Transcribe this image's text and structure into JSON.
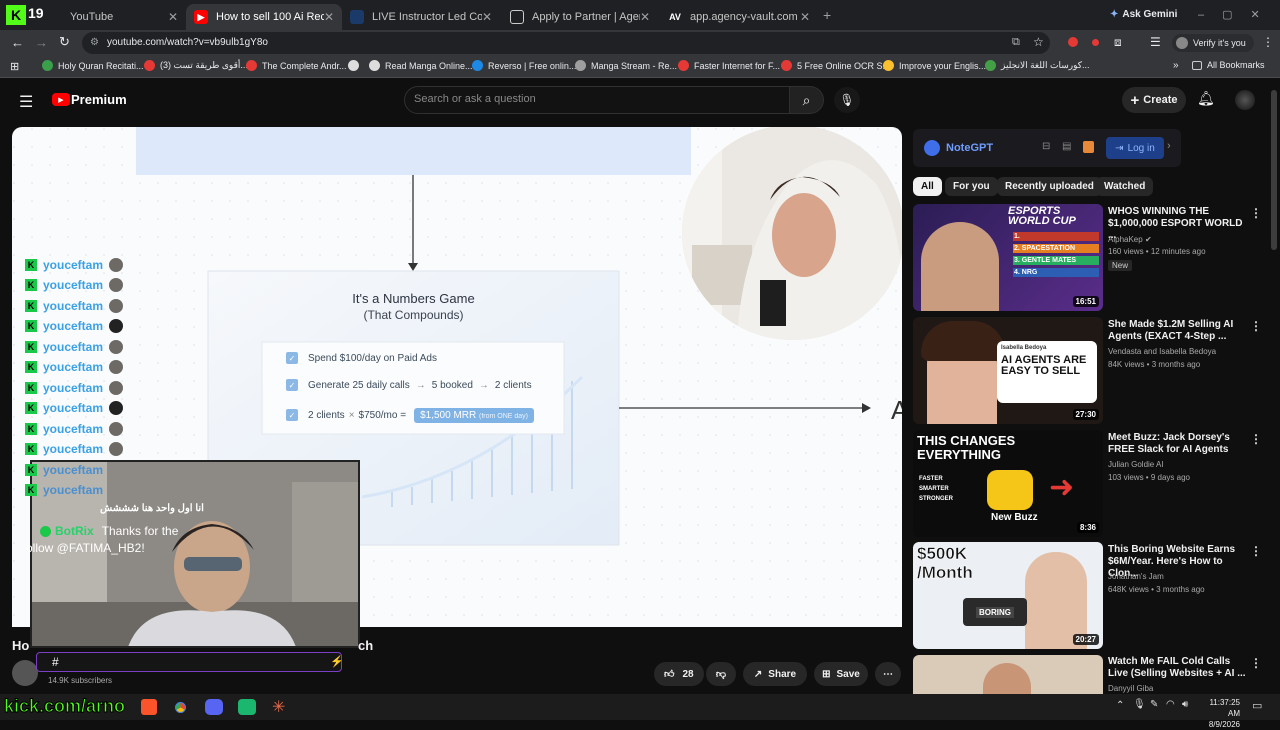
{
  "browser": {
    "tabs": [
      {
        "label": "YouTube",
        "favicon": "K"
      },
      {
        "label": "How to sell 100 Ai Receptionist",
        "favicon": "▶"
      },
      {
        "label": "LIVE Instructor Led Course: QA",
        "favicon": "▬"
      },
      {
        "label": "Apply to Partner | Agency Vault",
        "favicon": "☐"
      },
      {
        "label": "app.agency-vault.com",
        "favicon": "AV"
      }
    ],
    "kick_count": "19",
    "ask_gemini": "Ask Gemini",
    "url": "youtube.com/watch?v=vb9ulb1gY8o",
    "verify": "Verify it's you",
    "bookmarks": [
      {
        "label": "Holy Quran Recitati...",
        "color": "#3aa04a"
      },
      {
        "label": "(3) أقوى طريقة تست...",
        "color": "#e53935"
      },
      {
        "label": "The Complete Andr...",
        "color": "#e53935"
      },
      {
        "label": "",
        "color": "#dddddd"
      },
      {
        "label": "Read Manga Online...",
        "color": "#dddddd"
      },
      {
        "label": "Reverso | Free onlin...",
        "color": "#1e88e5"
      },
      {
        "label": "Manga Stream - Re...",
        "color": "#9e9e9e"
      },
      {
        "label": "Faster Internet for F...",
        "color": "#e53935"
      },
      {
        "label": "5 Free Online OCR S...",
        "color": "#e53935"
      },
      {
        "label": "Improve your Englis...",
        "color": "#fbc02d"
      },
      {
        "label": "كورسات اللغة الانجليز...",
        "color": "#43a047"
      }
    ],
    "all_bookmarks": "All Bookmarks"
  },
  "yt": {
    "logo": "Premium",
    "search_placeholder": "Search or ask a question",
    "create": "Create"
  },
  "slide": {
    "title": "It's a Numbers Game",
    "subtitle": "(That Compounds)",
    "row1": "Spend $100/day on Paid Ads",
    "row2_a": "Generate 25 daily calls",
    "row2_b": "5 booked",
    "row2_c": "2 clients",
    "row3_a": "2 clients",
    "row3_b": "$750/mo =",
    "row3_pill": "$1,500 MRR",
    "row3_pill_note": "(from ONE day)",
    "edge_letter": "A"
  },
  "chat": {
    "username": "youceftam",
    "rows": 10,
    "bot_name": "BotRix",
    "bot_msg_a": "Thanks for the",
    "bot_msg_b": "ollow @FATIMA_HB2!",
    "arabic_msg": "انا اول واحد هنا شششش"
  },
  "video": {
    "title_left": "Ho",
    "title_right": "ch",
    "subscribers": "14.9K subscribers",
    "likes": "28",
    "share": "Share",
    "save": "Save"
  },
  "notegpt": {
    "name": "NoteGPT",
    "login": "Log in"
  },
  "chips": [
    "All",
    "For you",
    "Recently uploaded",
    "Watched"
  ],
  "recs": [
    {
      "title": "WHOS WINNING THE $1,000,000 ESPORT WORLD ...",
      "channel": "AlphaKep",
      "meta": "160 views • 12 minutes ago",
      "badge": "New",
      "duration": "16:51",
      "thumb_text": "ESPORTS WORLD CUP"
    },
    {
      "title": "She Made $1.2M Selling AI Agents (EXACT 4-Step ...",
      "channel": "Vendasta and Isabella Bedoya",
      "meta": "84K views • 3 months ago",
      "badge": "",
      "duration": "27:30",
      "thumb_text": "AI AGENTS ARE EASY TO SELL"
    },
    {
      "title": "Meet Buzz: Jack Dorsey's FREE Slack for AI Agents",
      "channel": "Julian Goldie AI",
      "meta": "103 views • 9 days ago",
      "badge": "",
      "duration": "8:36",
      "thumb_text": "THIS CHANGES EVERYTHING"
    },
    {
      "title": "This Boring Website Earns $6M/Year. Here's How to Clon...",
      "channel": "Jonathan's Jam",
      "meta": "648K views • 3 months ago",
      "badge": "",
      "duration": "20:27",
      "thumb_text": "$500K /Month"
    },
    {
      "title": "Watch Me FAIL Cold Calls Live (Selling Websites + AI ...",
      "channel": "Danyyil Giba",
      "meta": "",
      "badge": "",
      "duration": "",
      "thumb_text": ""
    }
  ],
  "rec_thumb_extra": {
    "rec1_rows": [
      "1.",
      "2. SPACESTATION",
      "3. GENTLE MATES",
      "4. NRG"
    ],
    "rec2_person": "Isabella Bedoya",
    "rec3_lines": [
      "FASTER",
      "SMARTER",
      "STRONGER"
    ],
    "rec3_label": "New Buzz",
    "rec4_label": "BORING"
  },
  "overlay_text": "kick.com/arno",
  "clock": {
    "time": "11:37:25 AM",
    "date": "8/9/2026"
  },
  "colors": {
    "yt_red": "#ff0000",
    "kick_green": "#53fc18",
    "accent_blue": "#3ea6ff"
  }
}
